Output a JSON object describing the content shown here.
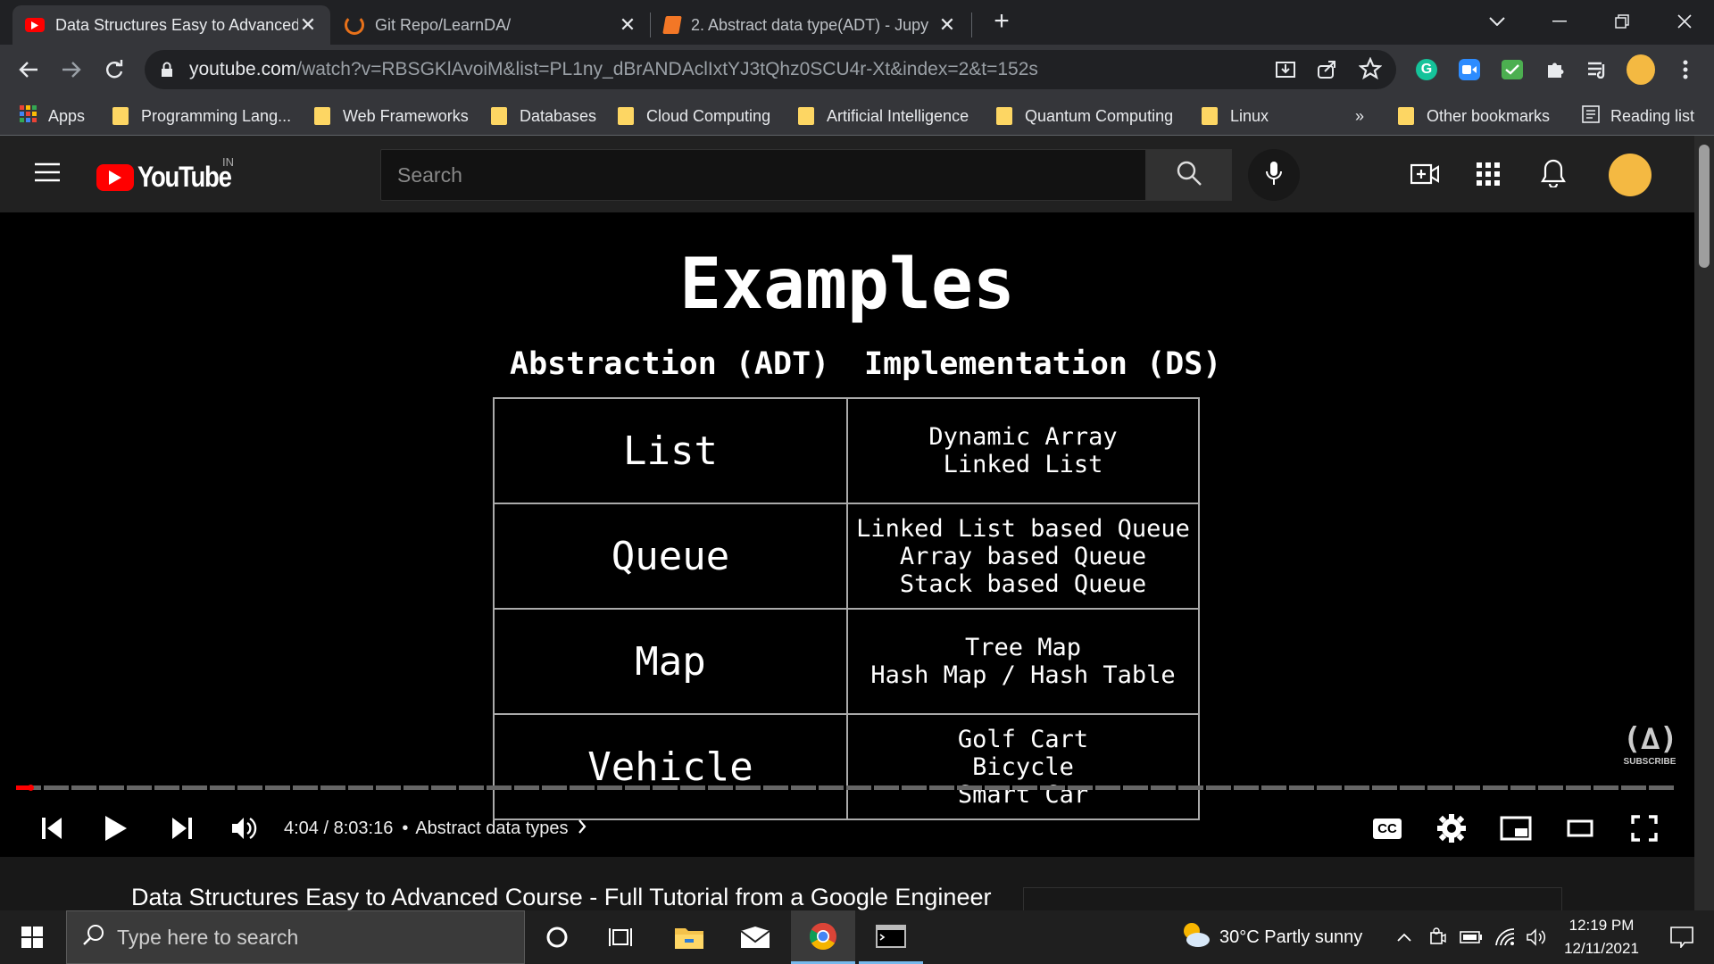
{
  "browser": {
    "tabs": [
      {
        "title": "Data Structures Easy to Advanced",
        "icon": "youtube-icon",
        "active": true
      },
      {
        "title": "Git Repo/LearnDA/",
        "icon": "loading-icon",
        "active": false
      },
      {
        "title": "2. Abstract data type(ADT) - Jupy",
        "icon": "jupyter-icon",
        "active": false
      }
    ],
    "url_host": "youtube.com",
    "url_path": "/watch?v=RBSGKlAvoiM&list=PL1ny_dBrANDAclIxtYJ3tQhz0SCU4r-Xt&index=2&t=152s",
    "bookmarks": [
      "Apps",
      "Programming Lang...",
      "Web Frameworks",
      "Databases",
      "Cloud Computing",
      "Artificial Intelligence",
      "Quantum Computing",
      "Linux"
    ],
    "bookmarks_overflow": "»",
    "other_bookmarks": "Other bookmarks",
    "reading_list": "Reading list"
  },
  "youtube": {
    "logo_text": "YouTube",
    "country_code": "IN",
    "search_placeholder": "Search"
  },
  "slide": {
    "title": "Examples",
    "col_adt": "Abstraction (ADT)",
    "col_ds": "Implementation (DS)",
    "rows": [
      {
        "adt": "List",
        "impl": [
          "Dynamic Array",
          "Linked List"
        ]
      },
      {
        "adt": "Queue",
        "impl": [
          "Linked List based Queue",
          "Array based Queue",
          "Stack based Queue"
        ]
      },
      {
        "adt": "Map",
        "impl": [
          "Tree Map",
          "Hash Map / Hash Table"
        ]
      },
      {
        "adt": "Vehicle",
        "impl": [
          "Golf Cart",
          "Bicycle",
          "Smart Car"
        ]
      }
    ],
    "subscribe_label": "SUBSCRIBE"
  },
  "player": {
    "time": "4:04 / 8:03:16",
    "separator": "•",
    "chapter": "Abstract data types",
    "progress_fraction": 0.0084,
    "cc_label": "CC"
  },
  "video": {
    "title": "Data Structures Easy to Advanced Course - Full Tutorial from a Google Engineer"
  },
  "taskbar": {
    "search_placeholder": "Type here to search",
    "weather": "30°C  Partly sunny",
    "time": "12:19 PM",
    "date": "12/11/2021"
  },
  "colors": {
    "youtube_red": "#ff0000",
    "folder_yellow": "#fdd663",
    "avatar": "#f4b942"
  }
}
